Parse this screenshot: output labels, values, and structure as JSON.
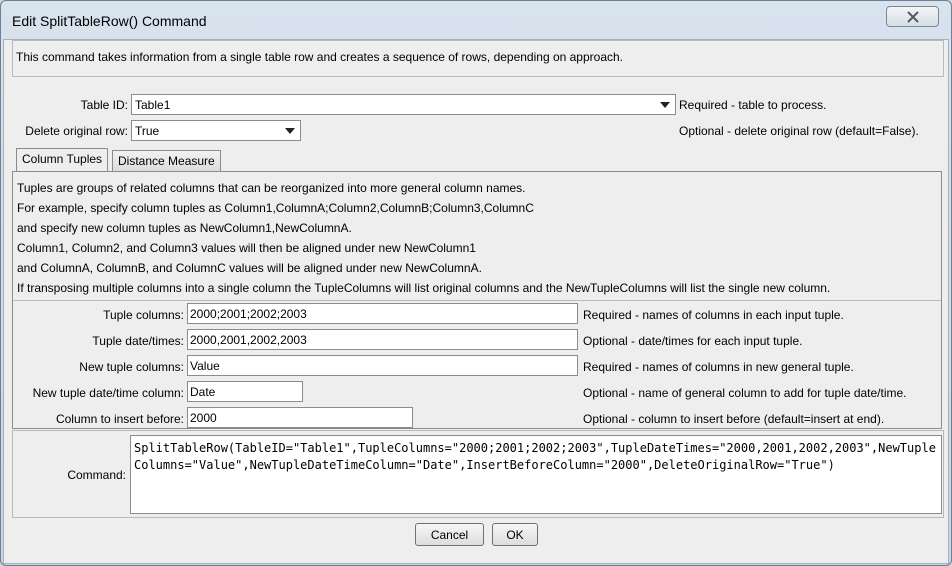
{
  "window": {
    "title": "Edit SplitTableRow() Command"
  },
  "description": "This command takes information from a single table row and creates a sequence of rows, depending on approach.",
  "table_id": {
    "label": "Table ID:",
    "value": "Table1",
    "help": "Required - table to process."
  },
  "delete_original_row": {
    "label": "Delete original row:",
    "value": "True",
    "help": "Optional - delete original row (default=False)."
  },
  "tabs": [
    {
      "label": "Column Tuples"
    },
    {
      "label": "Distance Measure"
    }
  ],
  "tuple_help": [
    "Tuples are groups of related columns that can be reorganized into more general column names.",
    "For example, specify column tuples as Column1,ColumnA;Column2,ColumnB;Column3,ColumnC",
    "and specify new column tuples as NewColumn1,NewColumnA.",
    "Column1, Column2, and Column3 values will then be aligned under new NewColumn1",
    "and ColumnA, ColumnB, and ColumnC values will be aligned under new NewColumnA.",
    "If transposing multiple columns into a single column the TupleColumns will list original columns and the NewTupleColumns will list the single new column."
  ],
  "fields": {
    "tuple_columns": {
      "label": "Tuple columns:",
      "value": "2000;2001;2002;2003",
      "help": "Required - names of columns in each input tuple."
    },
    "tuple_datetimes": {
      "label": "Tuple date/times:",
      "value": "2000,2001,2002,2003",
      "help": "Optional - date/times for each input tuple."
    },
    "new_tuple_columns": {
      "label": "New tuple columns:",
      "value": "Value",
      "help": "Required - names of columns in new general tuple."
    },
    "new_tuple_datetime_column": {
      "label": "New tuple date/time column:",
      "value": "Date",
      "help": "Optional - name of general column to add for tuple date/time."
    },
    "insert_before": {
      "label": "Column to insert before:",
      "value": "2000",
      "help": "Optional - column to insert before (default=insert at end)."
    }
  },
  "command": {
    "label": "Command:",
    "value": "SplitTableRow(TableID=\"Table1\",TupleColumns=\"2000;2001;2002;2003\",TupleDateTimes=\"2000,2001,2002,2003\",NewTupleColumns=\"Value\",NewTupleDateTimeColumn=\"Date\",InsertBeforeColumn=\"2000\",DeleteOriginalRow=\"True\")"
  },
  "buttons": {
    "cancel": "Cancel",
    "ok": "OK"
  },
  "icons": {
    "close": "close-icon",
    "dropdown": "chevron-down-icon"
  }
}
